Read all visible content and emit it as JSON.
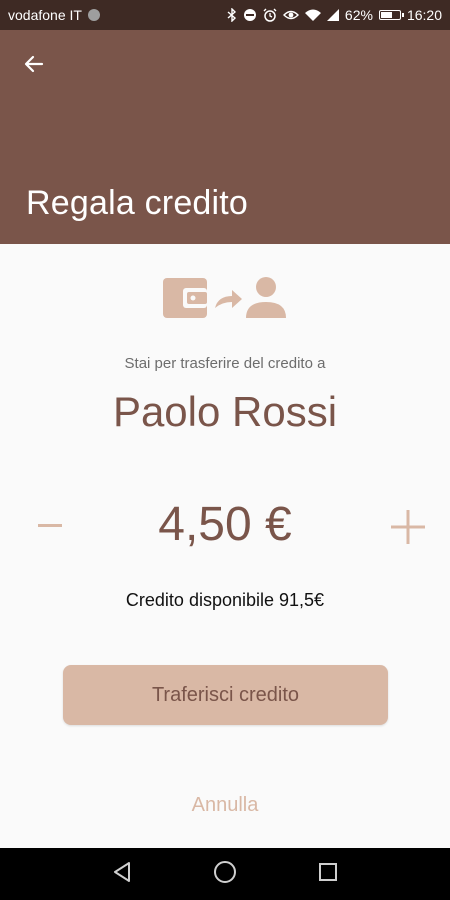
{
  "status_bar": {
    "carrier": "vodafone IT",
    "battery": "62%",
    "time": "16:20",
    "battery_level": 0.62,
    "icons": [
      "bluetooth-icon",
      "do-not-disturb-icon",
      "alarm-icon",
      "eye-icon",
      "wifi-icon",
      "signal-icon",
      "battery-icon"
    ]
  },
  "app_bar": {
    "title": "Regala credito",
    "back_icon": "arrow-back-icon",
    "background": "#7a554a"
  },
  "transfer": {
    "illustration_icons": [
      "wallet-icon",
      "share-arrow-icon",
      "person-icon"
    ],
    "subtitle": "Stai per trasferire del credito a",
    "recipient": "Paolo Rossi",
    "amount": "4,50 €",
    "minus_icon": "minus-icon",
    "plus_icon": "plus-icon",
    "available_credit": "Credito disponibile 91,5€",
    "transfer_button": "Traferisci credito",
    "cancel": "Annulla"
  },
  "colors": {
    "brand": "#7a554a",
    "accent": "#d9b8a5",
    "status_bar": "#3e2a24"
  },
  "nav_bar": {
    "icons": [
      "back-triangle-icon",
      "home-circle-icon",
      "recents-square-icon"
    ]
  }
}
